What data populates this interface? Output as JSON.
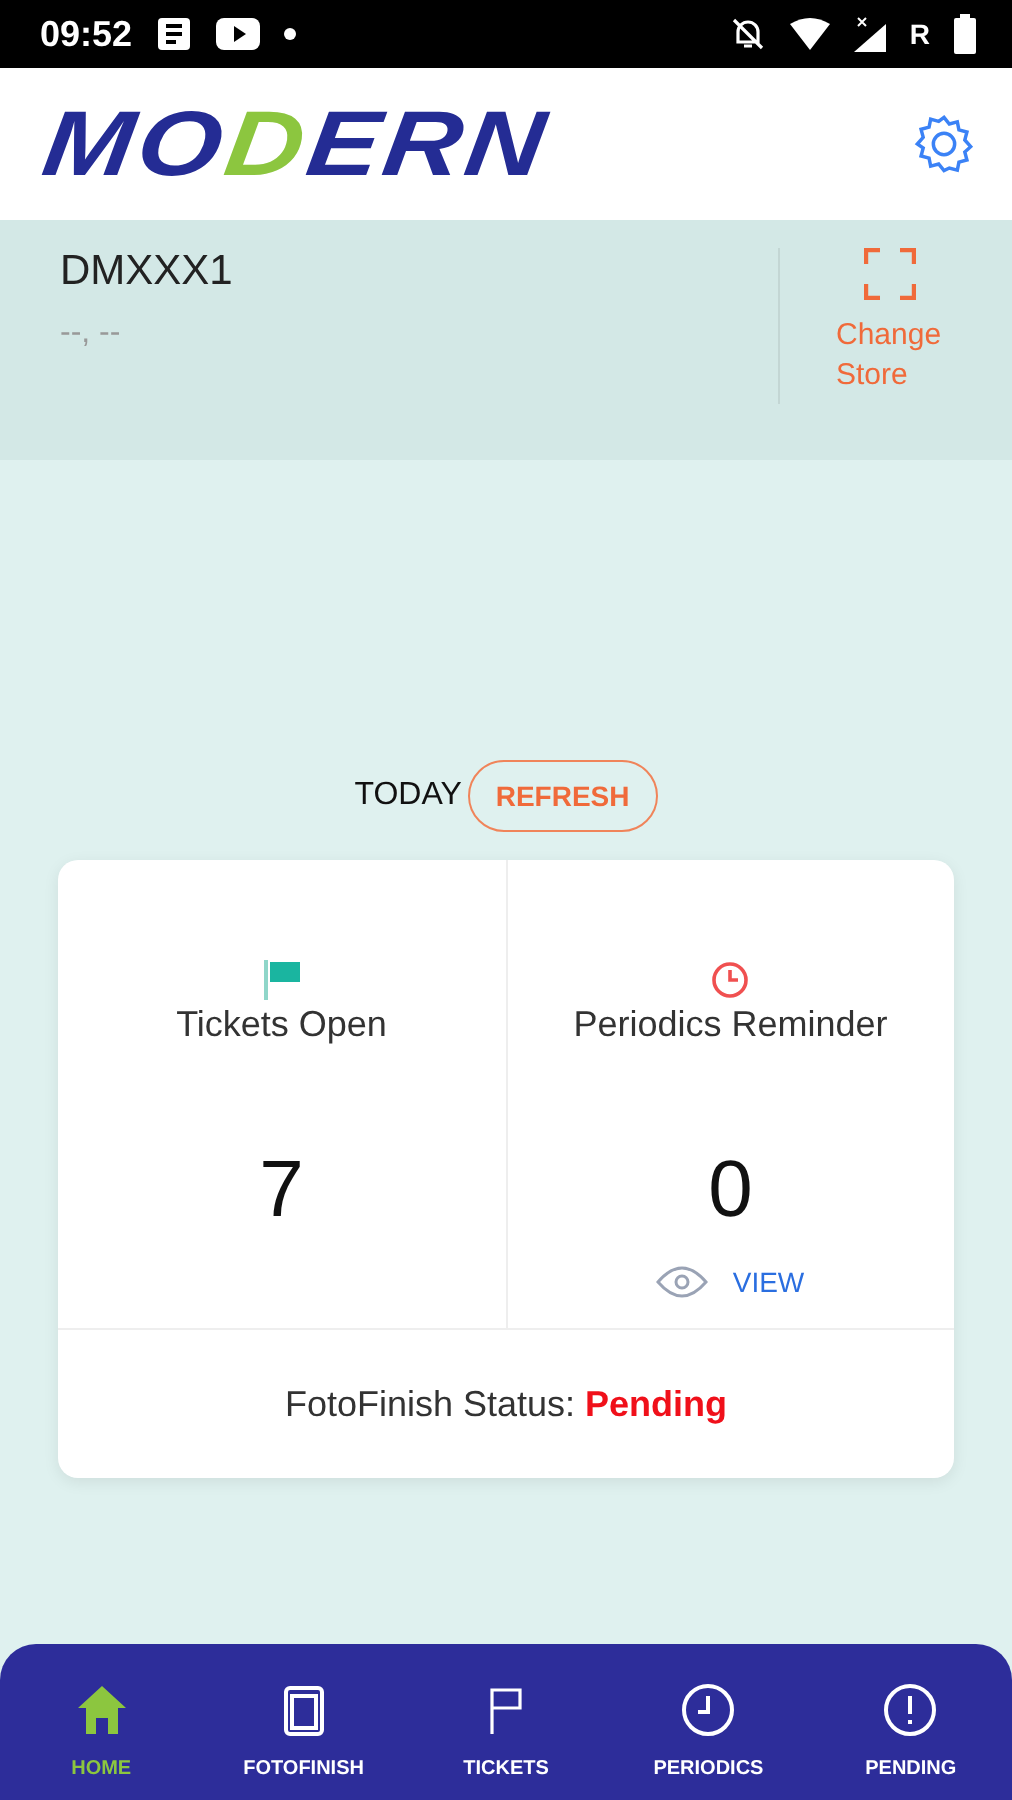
{
  "status_bar": {
    "time": "09:52",
    "network_label": "R"
  },
  "header": {
    "logo": "MODERN"
  },
  "store": {
    "code": "DMXXX1",
    "location": "--, --",
    "change_button": "Change Store"
  },
  "today": {
    "label": "TODAY",
    "refresh_button": "REFRESH"
  },
  "stats": [
    {
      "kind": "tickets",
      "label": "Tickets Open",
      "value": "7"
    },
    {
      "kind": "periodics",
      "label": "Periodics Reminder",
      "value": "0",
      "link": "VIEW"
    }
  ],
  "fotofinish": {
    "label": "FotoFinish Status:",
    "status": "Pending"
  },
  "nav": [
    {
      "kind": "home",
      "label": "HOME",
      "selected": true
    },
    {
      "kind": "fotofinish",
      "label": "FOTOFINISH",
      "selected": false
    },
    {
      "kind": "tickets",
      "label": "TICKETS",
      "selected": false
    },
    {
      "kind": "periodics",
      "label": "PERIODICS",
      "selected": false
    },
    {
      "kind": "pending",
      "label": "PENDING",
      "selected": false
    }
  ]
}
